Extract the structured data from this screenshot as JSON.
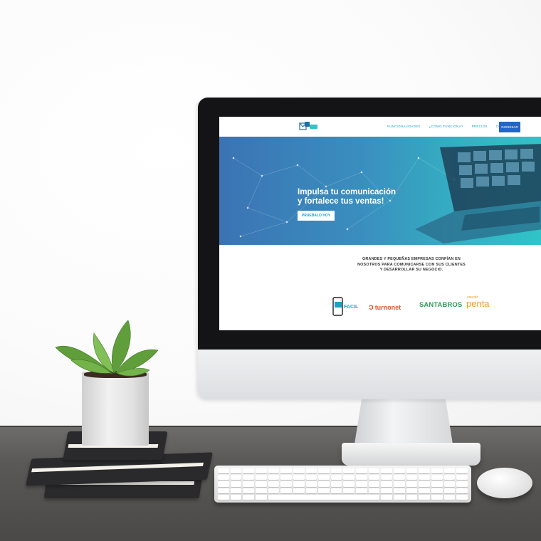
{
  "site": {
    "nav": {
      "links": [
        "FUNCIONALIDADES",
        "¿CÓMO FUNCIONA?",
        "PRECIOS",
        "CONTACTO"
      ],
      "cta": "INGRESAR"
    },
    "hero": {
      "title": "Impulsa tu comunicación\ny fortalece tus ventas!",
      "button": "PRUEBALO HOY"
    },
    "trust_text": "GRANDES Y PEQUEÑAS EMPRESAS CONFÍAN EN\nNOSOTROS PARA COMUNICARSE CON SUS CLIENTES\nY DESARROLLAR SU NEGOCIO.",
    "brands": {
      "smsfacil": "FACIL",
      "turnonet": "turnonet",
      "santabros": "SANTABROS",
      "penta_small": "estudio",
      "penta_big": "penta"
    }
  },
  "colors": {
    "accent": "#1fa1c7",
    "button": "#2266c7",
    "hero_start": "#3b73b4",
    "hero_end": "#2fc4c7"
  }
}
